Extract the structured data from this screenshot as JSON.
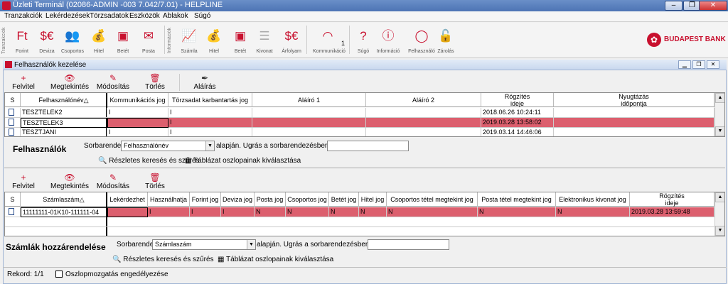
{
  "window": {
    "title": "Üzleti Terminál (02086-ADMIN   -003 7.042/7.01) - HELPLINE",
    "min": "–",
    "max": "❐",
    "close": "✕"
  },
  "menu": [
    "Tranzakciók",
    "Lekérdezések",
    "Törzsadatok",
    "Eszközök",
    "Ablakok",
    "Súgó"
  ],
  "toolbar": {
    "group1_label": "Tranzakciók",
    "group2_label": "Információk",
    "buttons": [
      "Forint",
      "Deviza",
      "Csoportos",
      "Hitel",
      "Betét",
      "Posta",
      "Számla",
      "Hitel",
      "Betét",
      "Kivonat",
      "Árfolyam",
      "Kommunikáció",
      "Súgó",
      "Információ",
      "Felhasználó",
      "Zárolás"
    ],
    "comm_count": "1",
    "bank_logo": "BUDAPEST BANK"
  },
  "inner_window": {
    "title": "Felhasználók kezelése"
  },
  "actions_top": [
    "Felvitel",
    "Megtekintés",
    "Módosítás",
    "Törlés",
    "Aláírás"
  ],
  "actions_bottom": [
    "Felvitel",
    "Megtekintés",
    "Módosítás",
    "Törlés"
  ],
  "users_table": {
    "headers": [
      "S",
      "Felhasználónév",
      "Kommunikációs jog",
      "Törzsadat karbantartás jog",
      "Aláíró 1",
      "Aláíró 2",
      "Rögzítés\nideje",
      "Nyugtázás\nidőpontja"
    ],
    "sort_mark": "△",
    "rows": [
      {
        "name": "TESZTELEK2",
        "comm": "I",
        "torzs": "I",
        "a1": "",
        "a2": "",
        "rogzites": "2018.06.26 10:24:11",
        "nyugta": "",
        "selected": false
      },
      {
        "name": "TESZTELEK3",
        "comm": "",
        "torzs": "I",
        "a1": "",
        "a2": "",
        "rogzites": "2019.03.28 13:58:02",
        "nyugta": "",
        "selected": true
      },
      {
        "name": "TESZTJANI",
        "comm": "I",
        "torzs": "I",
        "a1": "",
        "a2": "",
        "rogzites": "2019.03.14 14:46:06",
        "nyugta": "",
        "selected": false
      }
    ]
  },
  "users_section": {
    "title": "Felhasználók",
    "sort_label": "Sorbarendezve",
    "sort_value": "Felhasználónév",
    "jump_label": "alapján.  Ugrás a sorbarendezésben:",
    "search_link": "Részletes keresés és szűrés",
    "columns_link": "Táblázat oszlopainak kiválasztása"
  },
  "accounts_table": {
    "headers": [
      "S",
      "Számlaszám",
      "Lekérdezhet",
      "Használhatja",
      "Forint jog",
      "Deviza jog",
      "Posta jog",
      "Csoportos jog",
      "Betét jog",
      "Hitel jog",
      "Csoportos tétel megtekint jog",
      "Posta tétel megtekint jog",
      "Elektronikus kivonat jog",
      "Rögzítés\nideje"
    ],
    "sort_mark": "△",
    "rows": [
      {
        "szamla": "11111111-01K10-111111-04",
        "lekerd": "",
        "hasznal": "I",
        "forint": "I",
        "deviza": "I",
        "posta": "N",
        "csop": "N",
        "betet": "N",
        "hitel": "N",
        "csoptetel": "N",
        "postatetel": "N",
        "ekivonat": "N",
        "rogzites": "2019.03.28 13:59:48"
      }
    ]
  },
  "accounts_section": {
    "title": "Számlák hozzárendelése",
    "sort_label": "Sorbarendezve",
    "sort_value": "Számlaszám",
    "jump_label": "alapján.  Ugrás a sorbarendezésben:",
    "search_link": "Részletes keresés és szűrés",
    "columns_link": "Táblázat oszlopainak kiválasztása"
  },
  "status": {
    "record": "Rekord:  1/1",
    "checkbox_label": "Oszlopmozgatás engedélyezése"
  },
  "colors": {
    "accent": "#c8102e",
    "selected_row": "#dc5f6e"
  }
}
